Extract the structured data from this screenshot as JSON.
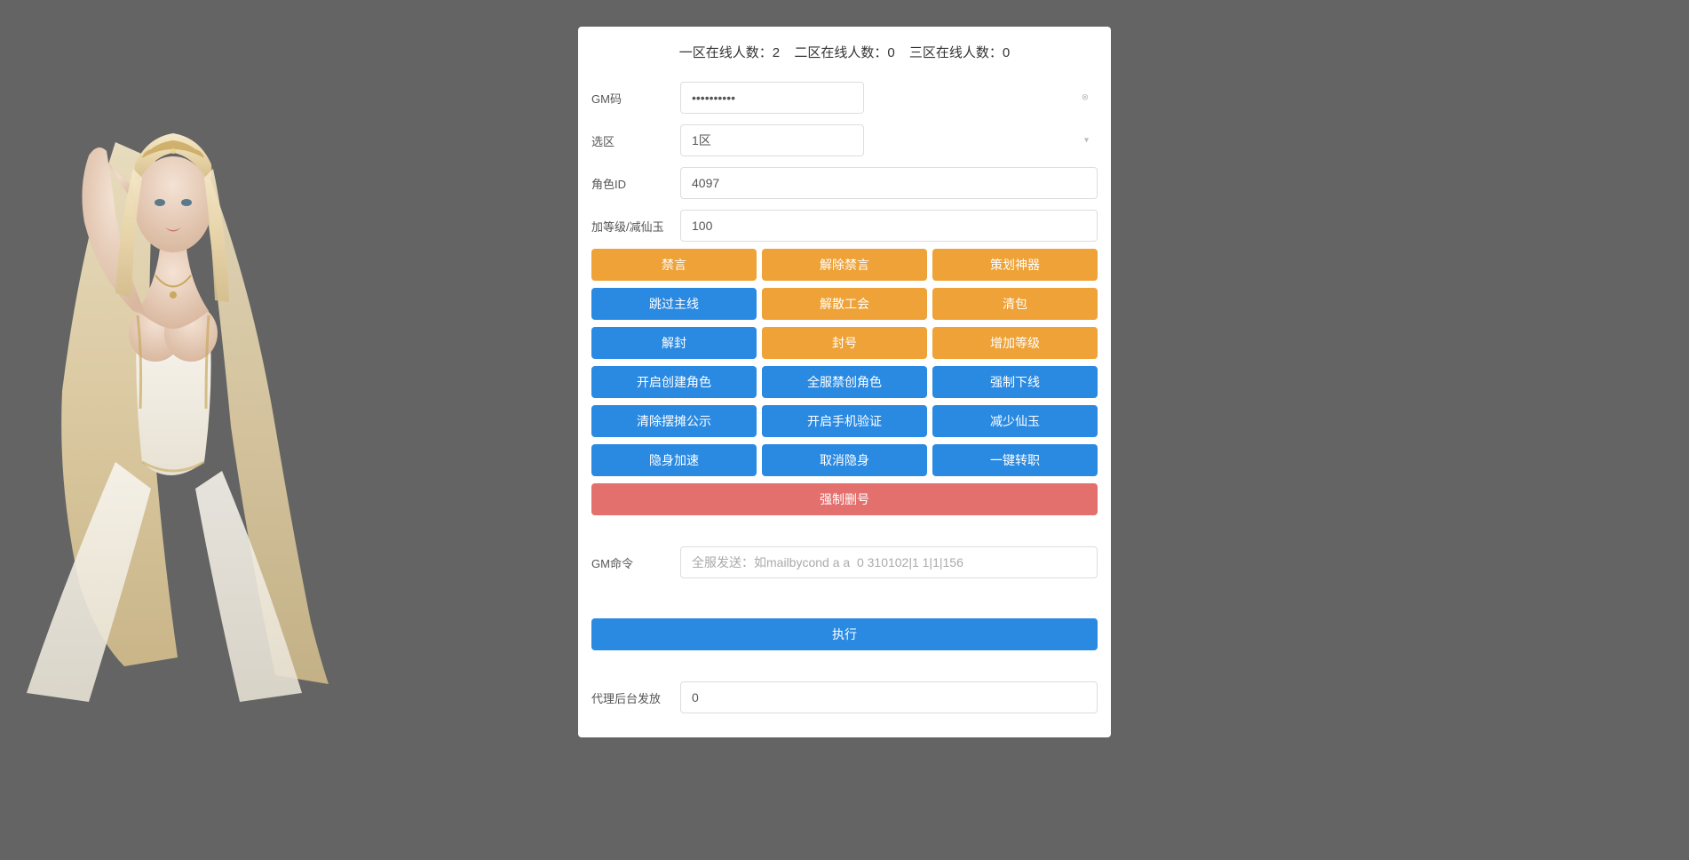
{
  "header": {
    "zone1_label": "一区在线人数：",
    "zone1_count": "2",
    "zone2_label": "二区在线人数：",
    "zone2_count": "0",
    "zone3_label": "三区在线人数：",
    "zone3_count": "0"
  },
  "form": {
    "gm_code_label": "GM码",
    "gm_code_value": "••••••••••",
    "zone_label": "选区",
    "zone_value": "1区",
    "role_id_label": "角色ID",
    "role_id_value": "4097",
    "level_label": "加等级/减仙玉",
    "level_value": "100",
    "gm_command_label": "GM命令",
    "gm_command_placeholder": "全服发送：如mailbycond a a  0 310102|1 1|1|156",
    "proxy_label": "代理后台发放",
    "proxy_value": "0"
  },
  "buttons": {
    "row1": [
      "禁言",
      "解除禁言",
      "策划神器"
    ],
    "row2": [
      "跳过主线",
      "解散工会",
      "清包"
    ],
    "row3": [
      "解封",
      "封号",
      "增加等级"
    ],
    "row4": [
      "开启创建角色",
      "全服禁创角色",
      "强制下线"
    ],
    "row5": [
      "清除摆摊公示",
      "开启手机验证",
      "减少仙玉"
    ],
    "row6": [
      "隐身加速",
      "取消隐身",
      "一键转职"
    ],
    "delete": "强制删号",
    "execute": "执行"
  },
  "row_colors": {
    "row1": [
      "orange",
      "orange",
      "orange"
    ],
    "row2": [
      "blue",
      "orange",
      "orange"
    ],
    "row3": [
      "blue",
      "orange",
      "orange"
    ],
    "row4": [
      "blue",
      "blue",
      "blue"
    ],
    "row5": [
      "blue",
      "blue",
      "blue"
    ],
    "row6": [
      "blue",
      "blue",
      "blue"
    ]
  }
}
